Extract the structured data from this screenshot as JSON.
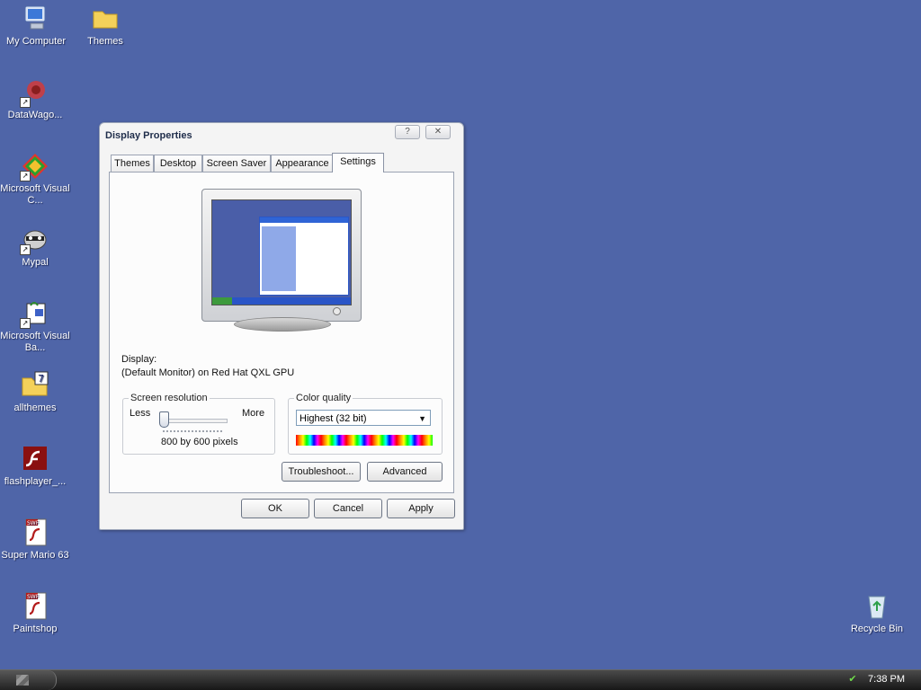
{
  "desktop": {
    "icons": [
      {
        "label": "My Computer",
        "icon": "computer-icon"
      },
      {
        "label": "Themes",
        "icon": "folder-icon"
      },
      {
        "label": "DataWago...",
        "icon": "datawagon-icon"
      },
      {
        "label": "Microsoft Visual C...",
        "icon": "visual-c-icon"
      },
      {
        "label": "Mypal",
        "icon": "mypal-icon"
      },
      {
        "label": "Microsoft Visual Ba...",
        "icon": "visual-basic-icon"
      },
      {
        "label": "allthemes",
        "icon": "folder-icon"
      },
      {
        "label": "flashplayer_...",
        "icon": "flash-icon"
      },
      {
        "label": "Super Mario 63",
        "icon": "swf-file-icon"
      },
      {
        "label": "Paintshop",
        "icon": "swf-file-icon"
      },
      {
        "label": "Recycle Bin",
        "icon": "recycle-bin-icon"
      }
    ]
  },
  "window": {
    "title": "Display Properties",
    "help_button": "?",
    "close_button": "✕",
    "tabs": [
      "Themes",
      "Desktop",
      "Screen Saver",
      "Appearance",
      "Settings"
    ],
    "active_tab": "Settings",
    "display_label": "Display:",
    "display_value": "(Default Monitor) on Red Hat QXL GPU",
    "screen_resolution": {
      "title": "Screen resolution",
      "less": "Less",
      "more": "More",
      "value_text": "800 by 600 pixels",
      "slider_position": 0
    },
    "color_quality": {
      "title": "Color quality",
      "selected": "Highest (32 bit)"
    },
    "buttons": {
      "troubleshoot": "Troubleshoot...",
      "advanced": "Advanced",
      "ok": "OK",
      "cancel": "Cancel",
      "apply": "Apply"
    }
  },
  "taskbar": {
    "clock": "7:38 PM"
  },
  "colors": {
    "desktop_background": "#4f65a8",
    "window_face": "#f4f4f4",
    "taskbar": "#1f1f1f"
  }
}
